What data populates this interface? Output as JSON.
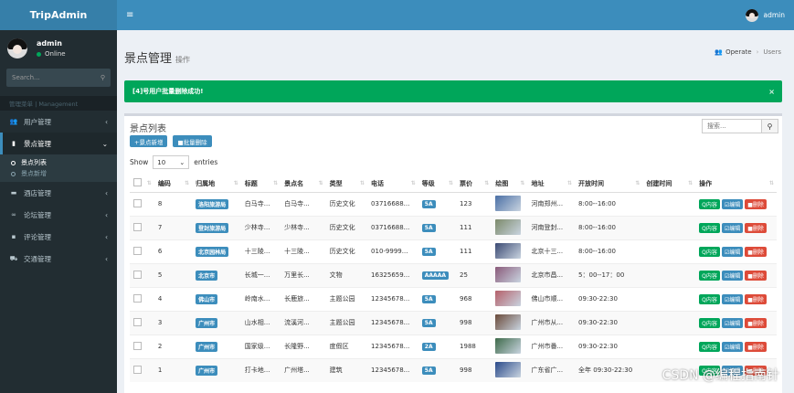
{
  "app": {
    "title": "TripAdmin"
  },
  "sidebar": {
    "user": {
      "name": "admin",
      "status": "Online"
    },
    "search_placeholder": "Search...",
    "section_header": "管理菜单 | Management",
    "menu": [
      {
        "label": "用户管理",
        "icon": "users-icon"
      },
      {
        "label": "景点管理",
        "icon": "book-icon",
        "active": true,
        "children": [
          {
            "label": "景点列表",
            "active": true
          },
          {
            "label": "景点新增"
          }
        ]
      },
      {
        "label": "酒店管理",
        "icon": "bed-icon"
      },
      {
        "label": "论坛管理",
        "icon": "link-icon"
      },
      {
        "label": "评论管理",
        "icon": "comment-icon"
      },
      {
        "label": "交通管理",
        "icon": "car-icon"
      }
    ]
  },
  "topbar": {
    "user": "admin"
  },
  "header": {
    "title": "景点管理",
    "subtitle": "操作"
  },
  "breadcrumb": {
    "items": [
      "Operate",
      "Users"
    ]
  },
  "alert": {
    "message": "[4]号用户批量删除成功!",
    "close": "×",
    "color": "#00a65a"
  },
  "box": {
    "title": "景点列表",
    "add_button": "+景点新增",
    "batch_delete_button": "■批量删除",
    "search_placeholder": "搜索...",
    "show_label": "Show",
    "page_length": "10",
    "entries_label": "entries"
  },
  "table": {
    "columns": [
      "",
      "编码",
      "归属地",
      "标题",
      "景点名",
      "类型",
      "电话",
      "等级",
      "票价",
      "绘图",
      "地址",
      "开放时间",
      "创建时间",
      "操作"
    ],
    "rows": [
      {
        "id": "8",
        "region": "洛阳旅游局",
        "title": "白马寺...",
        "name": "白马寺...",
        "type": "历史文化",
        "phone": "03716688...",
        "level": "5A",
        "price": "123",
        "img_color": "#4a6fa5",
        "address": "河南郑州...",
        "hours": "8:00--16:00",
        "created": ""
      },
      {
        "id": "7",
        "region": "登封旅游局",
        "title": "少林寺...",
        "name": "少林寺...",
        "type": "历史文化",
        "phone": "03716688...",
        "level": "5A",
        "price": "111",
        "img_color": "#7c8a6a",
        "address": "河南登封...",
        "hours": "8:00--16:00",
        "created": ""
      },
      {
        "id": "6",
        "region": "北京园林局",
        "title": "十三陵...",
        "name": "十三陵...",
        "type": "历史文化",
        "phone": "010-9999...",
        "level": "5A",
        "price": "111",
        "img_color": "#3b4a73",
        "address": "北京十三...",
        "hours": "8:00--16:00",
        "created": ""
      },
      {
        "id": "5",
        "region": "北京市",
        "title": "长城一...",
        "name": "万里长...",
        "type": "文物",
        "phone": "16325659...",
        "level": "AAAAA",
        "price": "25",
        "img_color": "#8a5a7a",
        "address": "北京市昌...",
        "hours": "5：00--17：00",
        "created": ""
      },
      {
        "id": "4",
        "region": "佛山市",
        "title": "岭南水...",
        "name": "长鹿旅...",
        "type": "主题公园",
        "phone": "12345678...",
        "level": "5A",
        "price": "968",
        "img_color": "#b5606a",
        "address": "佛山市顺...",
        "hours": "09:30-22:30",
        "created": ""
      },
      {
        "id": "3",
        "region": "广州市",
        "title": "山水相...",
        "name": "流溪河...",
        "type": "主题公园",
        "phone": "12345678...",
        "level": "5A",
        "price": "998",
        "img_color": "#6a4a3a",
        "address": "广州市从...",
        "hours": "09:30-22:30",
        "created": ""
      },
      {
        "id": "2",
        "region": "广州市",
        "title": "国家级...",
        "name": "长隆野...",
        "type": "度假区",
        "phone": "12345678...",
        "level": "2A",
        "price": "1988",
        "img_color": "#3e6a4a",
        "address": "广州市番...",
        "hours": "09:30-22:30",
        "created": ""
      },
      {
        "id": "1",
        "region": "广州市",
        "title": "打卡地...",
        "name": "广州塔...",
        "type": "建筑",
        "phone": "12345678...",
        "level": "5A",
        "price": "998",
        "img_color": "#2a4a8a",
        "address": "广东省广...",
        "hours": "全年 09:30-22:30",
        "created": ""
      }
    ],
    "row_actions": {
      "view": "Q内容",
      "edit": "☑编辑",
      "delete": "■删除"
    }
  },
  "watermark": "CSDN @编程指南针",
  "colors": {
    "primary": "#3c8dbc",
    "sidebar": "#222d32",
    "success": "#00a65a",
    "danger": "#dd4b39"
  }
}
